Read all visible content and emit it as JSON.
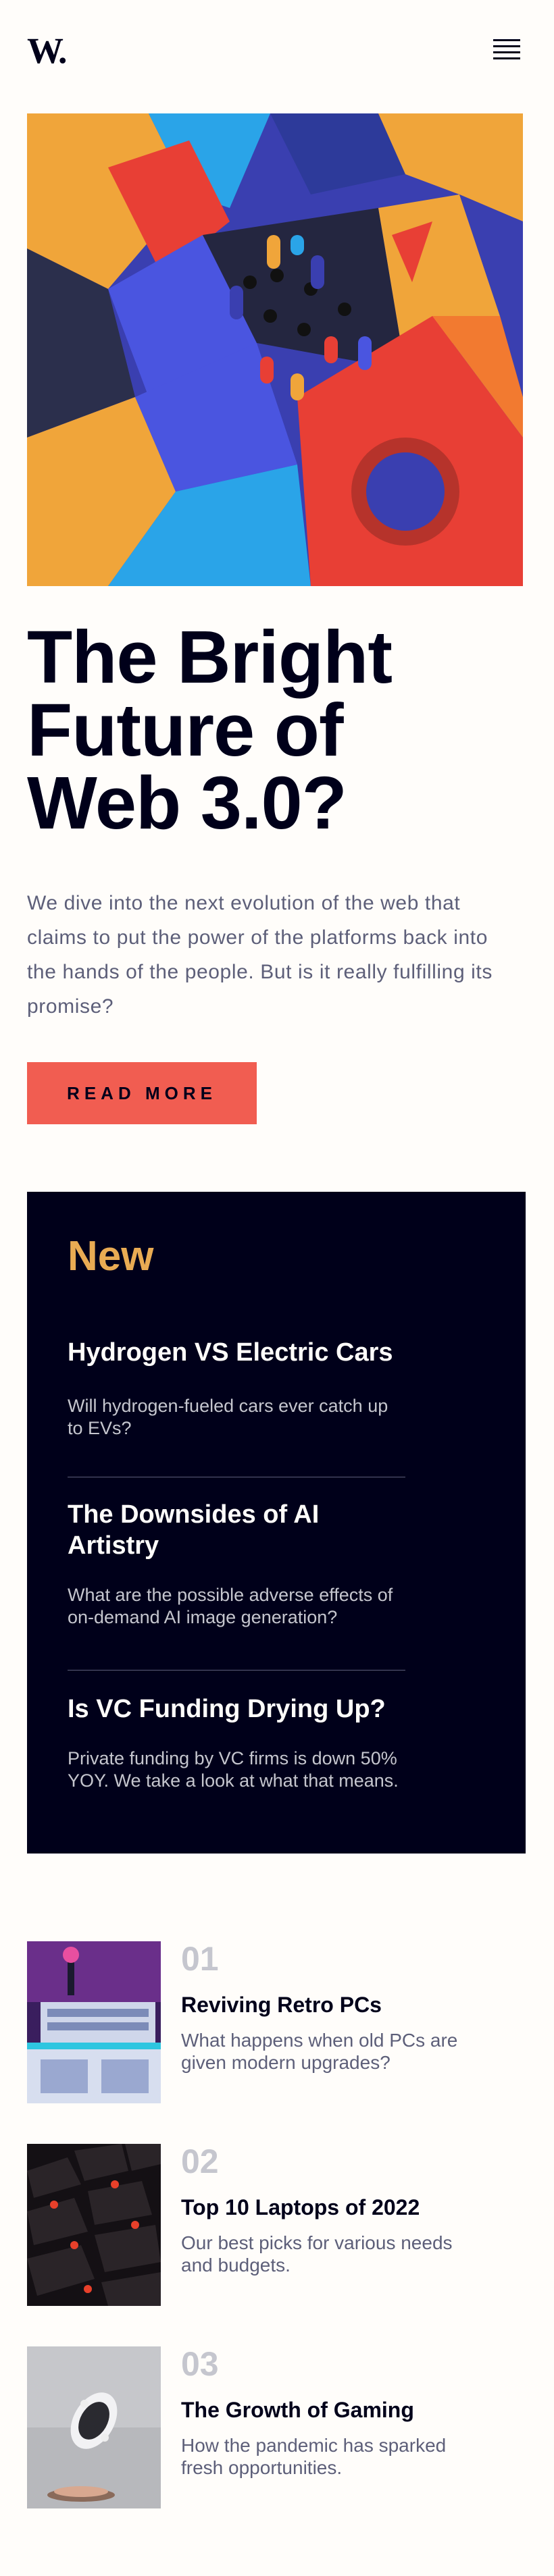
{
  "header": {
    "logo": "W.",
    "menu_icon": "hamburger-menu-icon"
  },
  "hero": {
    "image": "abstract-3d-shapes-image",
    "title": "The Bright Future of Web 3.0?",
    "text": "We dive into the next evolution of the web that claims to put the power of the platforms back into the hands of the people. But is it really fulfilling its promise?",
    "cta": "READ MORE"
  },
  "new_section": {
    "title": "New",
    "items": [
      {
        "title": "Hydrogen VS Electric Cars",
        "text": "Will hydrogen-fueled cars ever catch up to EVs?"
      },
      {
        "title": "The Downsides of AI Artistry",
        "text": "What are the possible adverse effects of on-demand AI image generation?"
      },
      {
        "title": "Is VC Funding Drying Up?",
        "text": "Private funding by VC firms is down 50% YOY. We take a look at what that means."
      }
    ]
  },
  "articles": [
    {
      "number": "01",
      "title": "Reviving Retro PCs",
      "text": "What happens when old PCs are given modern upgrades?",
      "image": "retro-pc-image"
    },
    {
      "number": "02",
      "title": "Top 10 Laptops of 2022",
      "text": "Our best picks for various needs and budgets.",
      "image": "keyboard-image"
    },
    {
      "number": "03",
      "title": "The Growth of Gaming",
      "text": "How the pandemic has sparked fresh opportunities.",
      "image": "game-controller-image"
    }
  ],
  "colors": {
    "background": "#fffdfa",
    "dark": "#00001a",
    "accent_red": "#f15d51",
    "accent_orange": "#e9ab53",
    "grayish_blue": "#5d5f79",
    "light_gray": "#c5c6ce"
  }
}
